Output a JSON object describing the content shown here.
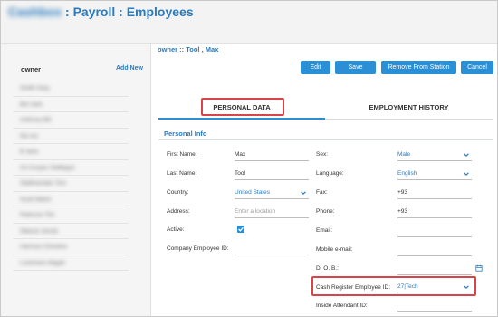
{
  "header": {
    "title_blurred": "Cashbox",
    "title_rest": " : Payroll : Employees"
  },
  "left_panel": {
    "header": "owner",
    "add_new": "Add New",
    "rows": [
      "Smith Gary",
      "Bet Jack",
      "Anthony Bill",
      "Nix Ice",
      "B Jane",
      "Art Cooper Staffapp1",
      "Staffmember Tom",
      "Scott Walsh",
      "Peterson Tim",
      "Watson Jessie",
      "Harrison Christine",
      "Lockmere Abigail"
    ]
  },
  "breadcrumb": "owner :: Tool , Max",
  "toolbar": {
    "edit": "Edit",
    "save": "Save",
    "remove": "Remove From Station",
    "cancel": "Cancel"
  },
  "tabs": {
    "personal": "PERSONAL DATA",
    "employment": "EMPLOYMENT HISTORY"
  },
  "section_title": "Personal Info",
  "form_left": {
    "first_name_label": "First Name:",
    "first_name_value": "Max",
    "last_name_label": "Last Name:",
    "last_name_value": "Tool",
    "country_label": "Country:",
    "country_value": "United States",
    "address_label": "Address:",
    "address_placeholder": "Enter a location",
    "active_label": "Active:",
    "company_id_label": "Company Employee ID:"
  },
  "form_right": {
    "sex_label": "Sex:",
    "sex_value": "Male",
    "language_label": "Language:",
    "language_value": "English",
    "fax_label": "Fax:",
    "fax_value": "+93",
    "phone_label": "Phone:",
    "phone_value": "+93",
    "email_label": "Email:",
    "mobile_label": "Mobile e-mail:",
    "dob_label": "D. O. B.:",
    "cash_register_label": "Cash Register Employee ID:",
    "cash_register_value": "27|Tech",
    "inside_attendant_label": "Inside Attendant ID:"
  },
  "colors": {
    "accent": "#2b8fd6",
    "title": "#2b7bbf",
    "highlight": "#d9434a"
  }
}
